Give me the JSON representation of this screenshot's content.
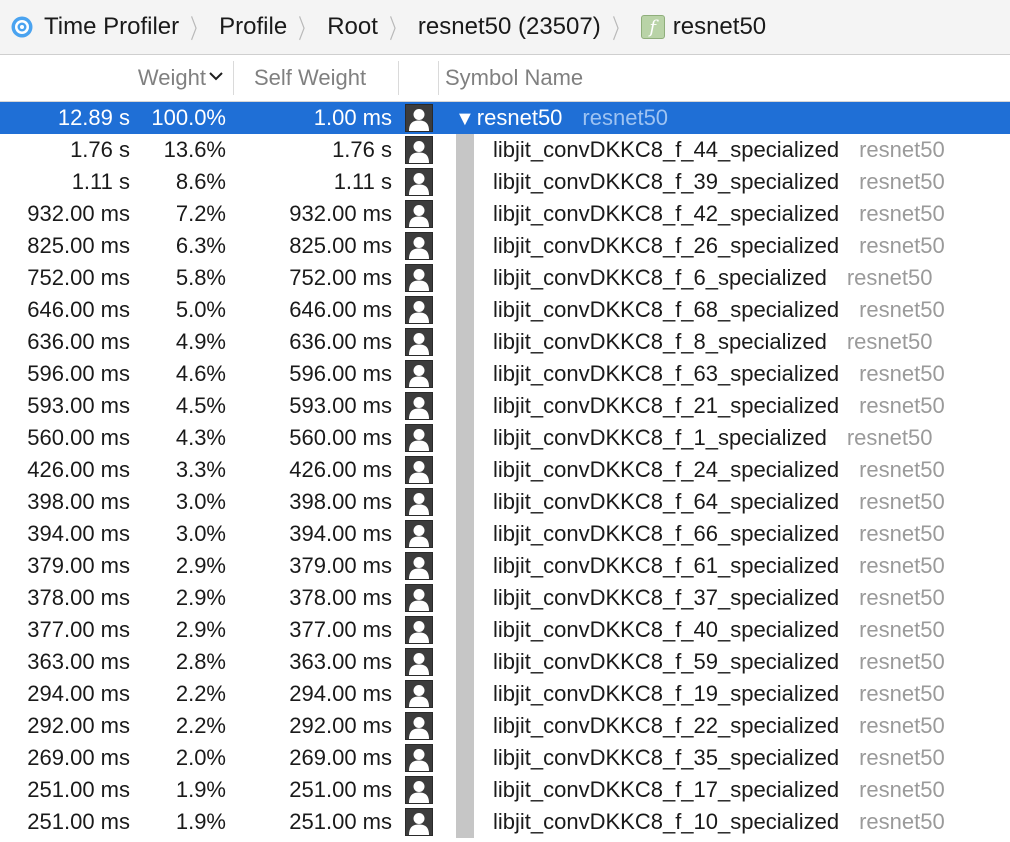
{
  "breadcrumb": [
    {
      "label": "Time Profiler",
      "icon": "time-profiler-icon"
    },
    {
      "label": "Profile"
    },
    {
      "label": "Root"
    },
    {
      "label": "resnet50 (23507)"
    },
    {
      "label": "resnet50",
      "icon": "function-icon"
    }
  ],
  "columns": {
    "weight": "Weight",
    "self_weight": "Self Weight",
    "symbol_name": "Symbol Name"
  },
  "colors": {
    "selection": "#1f6fd6",
    "library_text": "#9a9a9a"
  },
  "rows": [
    {
      "time": "12.89 s",
      "pct": "100.0%",
      "self": "1.00 ms",
      "symbol": "resnet50",
      "library": "resnet50",
      "selected": true,
      "expanded": true
    },
    {
      "time": "1.76 s",
      "pct": "13.6%",
      "self": "1.76 s",
      "symbol": "libjit_convDKKC8_f_44_specialized",
      "library": "resnet50"
    },
    {
      "time": "1.11 s",
      "pct": "8.6%",
      "self": "1.11 s",
      "symbol": "libjit_convDKKC8_f_39_specialized",
      "library": "resnet50"
    },
    {
      "time": "932.00 ms",
      "pct": "7.2%",
      "self": "932.00 ms",
      "symbol": "libjit_convDKKC8_f_42_specialized",
      "library": "resnet50"
    },
    {
      "time": "825.00 ms",
      "pct": "6.3%",
      "self": "825.00 ms",
      "symbol": "libjit_convDKKC8_f_26_specialized",
      "library": "resnet50"
    },
    {
      "time": "752.00 ms",
      "pct": "5.8%",
      "self": "752.00 ms",
      "symbol": "libjit_convDKKC8_f_6_specialized",
      "library": "resnet50"
    },
    {
      "time": "646.00 ms",
      "pct": "5.0%",
      "self": "646.00 ms",
      "symbol": "libjit_convDKKC8_f_68_specialized",
      "library": "resnet50"
    },
    {
      "time": "636.00 ms",
      "pct": "4.9%",
      "self": "636.00 ms",
      "symbol": "libjit_convDKKC8_f_8_specialized",
      "library": "resnet50"
    },
    {
      "time": "596.00 ms",
      "pct": "4.6%",
      "self": "596.00 ms",
      "symbol": "libjit_convDKKC8_f_63_specialized",
      "library": "resnet50"
    },
    {
      "time": "593.00 ms",
      "pct": "4.5%",
      "self": "593.00 ms",
      "symbol": "libjit_convDKKC8_f_21_specialized",
      "library": "resnet50"
    },
    {
      "time": "560.00 ms",
      "pct": "4.3%",
      "self": "560.00 ms",
      "symbol": "libjit_convDKKC8_f_1_specialized",
      "library": "resnet50"
    },
    {
      "time": "426.00 ms",
      "pct": "3.3%",
      "self": "426.00 ms",
      "symbol": "libjit_convDKKC8_f_24_specialized",
      "library": "resnet50"
    },
    {
      "time": "398.00 ms",
      "pct": "3.0%",
      "self": "398.00 ms",
      "symbol": "libjit_convDKKC8_f_64_specialized",
      "library": "resnet50"
    },
    {
      "time": "394.00 ms",
      "pct": "3.0%",
      "self": "394.00 ms",
      "symbol": "libjit_convDKKC8_f_66_specialized",
      "library": "resnet50"
    },
    {
      "time": "379.00 ms",
      "pct": "2.9%",
      "self": "379.00 ms",
      "symbol": "libjit_convDKKC8_f_61_specialized",
      "library": "resnet50"
    },
    {
      "time": "378.00 ms",
      "pct": "2.9%",
      "self": "378.00 ms",
      "symbol": "libjit_convDKKC8_f_37_specialized",
      "library": "resnet50"
    },
    {
      "time": "377.00 ms",
      "pct": "2.9%",
      "self": "377.00 ms",
      "symbol": "libjit_convDKKC8_f_40_specialized",
      "library": "resnet50"
    },
    {
      "time": "363.00 ms",
      "pct": "2.8%",
      "self": "363.00 ms",
      "symbol": "libjit_convDKKC8_f_59_specialized",
      "library": "resnet50"
    },
    {
      "time": "294.00 ms",
      "pct": "2.2%",
      "self": "294.00 ms",
      "symbol": "libjit_convDKKC8_f_19_specialized",
      "library": "resnet50"
    },
    {
      "time": "292.00 ms",
      "pct": "2.2%",
      "self": "292.00 ms",
      "symbol": "libjit_convDKKC8_f_22_specialized",
      "library": "resnet50"
    },
    {
      "time": "269.00 ms",
      "pct": "2.0%",
      "self": "269.00 ms",
      "symbol": "libjit_convDKKC8_f_35_specialized",
      "library": "resnet50"
    },
    {
      "time": "251.00 ms",
      "pct": "1.9%",
      "self": "251.00 ms",
      "symbol": "libjit_convDKKC8_f_17_specialized",
      "library": "resnet50"
    },
    {
      "time": "251.00 ms",
      "pct": "1.9%",
      "self": "251.00 ms",
      "symbol": "libjit_convDKKC8_f_10_specialized",
      "library": "resnet50"
    }
  ]
}
